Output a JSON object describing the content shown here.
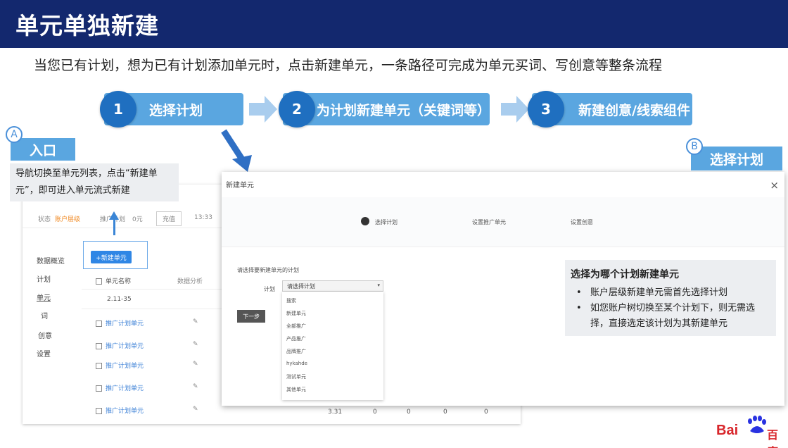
{
  "header": {
    "title": "单元单独新建"
  },
  "subtitle": "当您已有计划，想为已有计划添加单元时，点击新建单元，一条路径可完成为单元买词、写创意等整条流程",
  "steps": [
    {
      "num": "1",
      "label": "选择计划"
    },
    {
      "num": "2",
      "label": "为计划新建单元（关键词等）"
    },
    {
      "num": "3",
      "label": "新建创意/线索组件"
    }
  ],
  "entry": {
    "badge": "A",
    "label": "入口",
    "desc": "导航切换至单元列表，点击“新建单元”，即可进入单元流式新建"
  },
  "bg_panel": {
    "top_items": [
      "状态",
      "账户层级",
      "推广",
      "计划",
      "0元",
      "充值",
      "13:33"
    ],
    "sidebar": [
      "数据概览",
      "计划",
      "单元",
      "词",
      "创意",
      "设置"
    ],
    "new_unit_button": "+新建单元",
    "col_header": "单元名称",
    "col_status": "数据分析",
    "rows": [
      {
        "name": "2.11-35",
        "link": false
      },
      {
        "name": "推广计划单元",
        "link": true
      },
      {
        "name": "推广计划单元",
        "link": true
      },
      {
        "name": "推广计划单元",
        "link": true
      },
      {
        "name": "推广计划单元",
        "link": true
      },
      {
        "name": "推广计划单元",
        "link": true
      }
    ],
    "foot_values": [
      "3.31",
      "0",
      "0",
      "0",
      "0"
    ]
  },
  "dialog": {
    "title": "新建单元",
    "close": "×",
    "steps": [
      "选择计划",
      "设置推广单元",
      "设置创意"
    ],
    "hint": "请选择要新建单元的计划",
    "plan_label": "计划",
    "select_value": "请选择计划",
    "options": [
      "搜索",
      "新建单元",
      "全部推广",
      "产品推广",
      "品牌推广",
      "hykahde",
      "测试单元",
      "其他单元"
    ],
    "next_button": "下一步"
  },
  "note": {
    "title": "选择为哪个计划新建单元",
    "items": [
      "账户层级新建单元需首先选择计划",
      "如您账户树切换至某个计划下，则无需选择，直接选定该计划为其新建单元"
    ]
  },
  "section_b": {
    "badge": "B",
    "label": "选择计划"
  },
  "logo": {
    "text": "Bai",
    "suffix": "百度"
  },
  "colors": {
    "header": "#13286e",
    "accent": "#5aa6e0",
    "step_circle": "#1f6fc0"
  }
}
